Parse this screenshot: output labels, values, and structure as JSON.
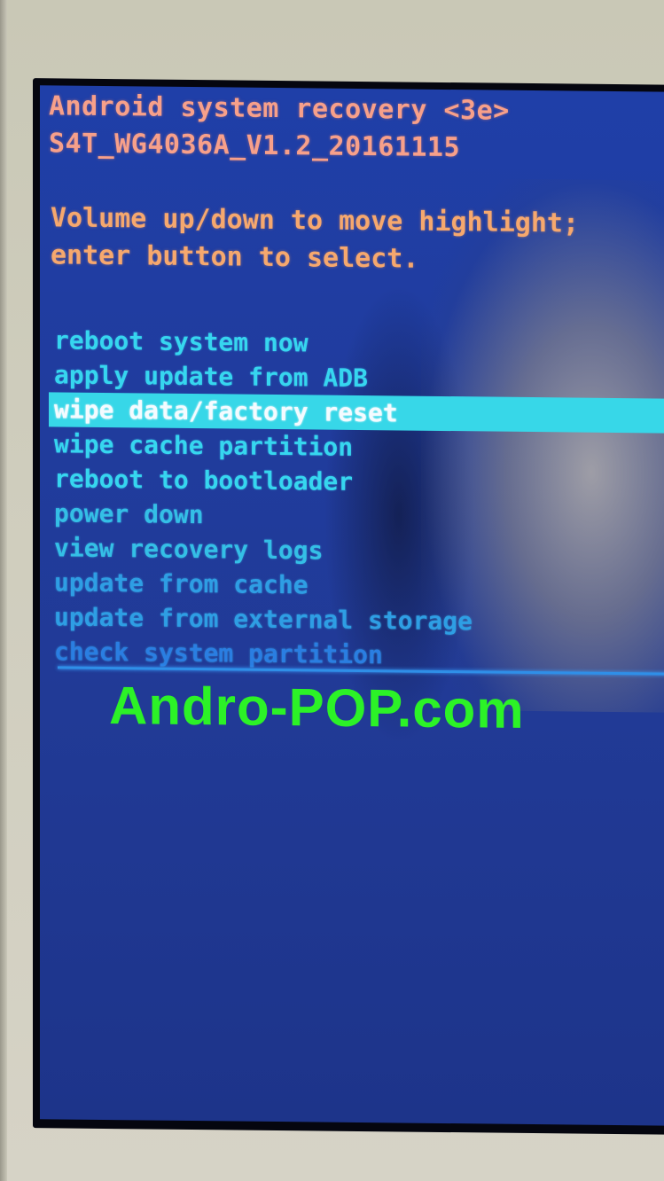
{
  "recovery": {
    "title": "Android system recovery <3e>",
    "build": "S4T_WG4036A_V1.2_20161115",
    "instructions": [
      "Volume up/down to move highlight;",
      "enter button to select."
    ],
    "menu": [
      {
        "label": "reboot system now",
        "selected": false
      },
      {
        "label": "apply update from ADB",
        "selected": false
      },
      {
        "label": "wipe data/factory reset",
        "selected": true
      },
      {
        "label": "wipe cache partition",
        "selected": false
      },
      {
        "label": "reboot to bootloader",
        "selected": false
      },
      {
        "label": "power down",
        "selected": false
      },
      {
        "label": "view recovery logs",
        "selected": false
      },
      {
        "label": "update from cache",
        "selected": false
      },
      {
        "label": "update from external storage",
        "selected": false
      },
      {
        "label": "check system partition",
        "selected": false
      }
    ]
  },
  "watermark": "Andro-POP.com",
  "colors": {
    "header_text": "#f7a08a",
    "hint_text": "#f6a86e",
    "menu_text": "#36d6ef",
    "highlight_bg": "#37d7e8",
    "screen_bg": "#203c9e",
    "watermark": "#2cf227",
    "bezel": "#cfcdbd"
  }
}
